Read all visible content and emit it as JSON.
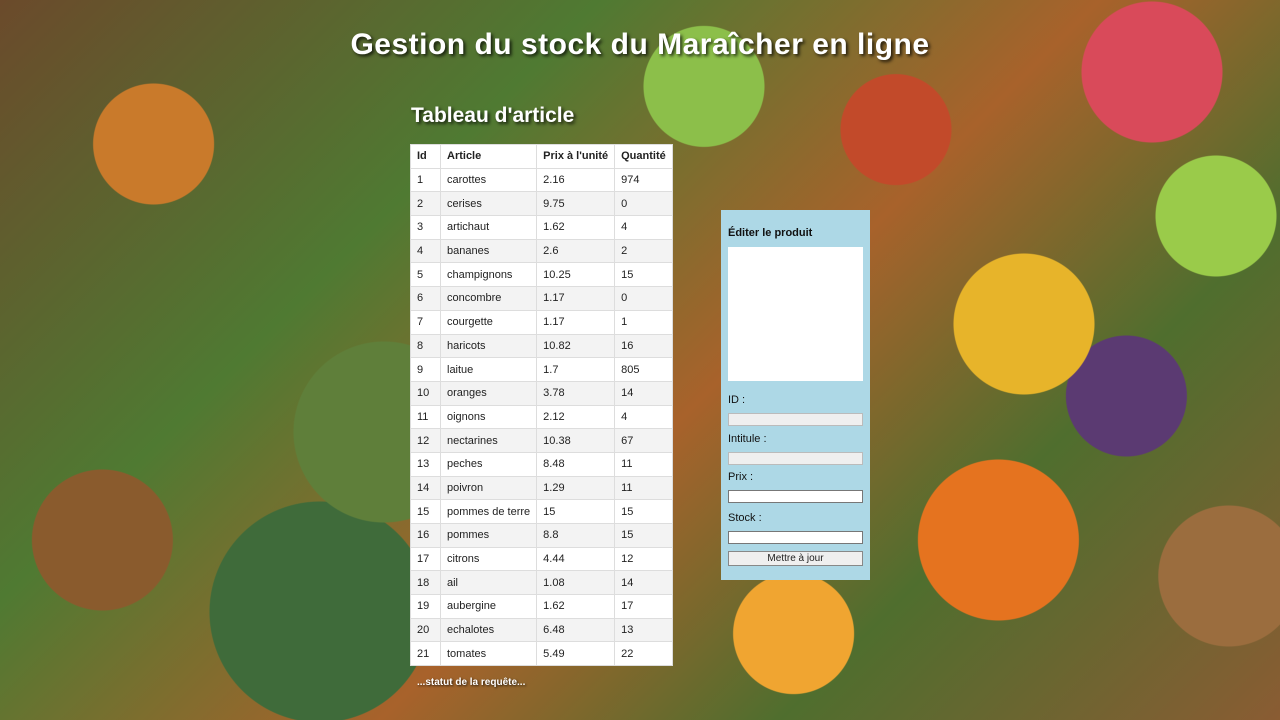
{
  "page": {
    "title": "Gestion du stock du Maraîcher en ligne",
    "table_title": "Tableau d'article",
    "status": "...statut de la requête..."
  },
  "table": {
    "headers": [
      "Id",
      "Article",
      "Prix à l'unité",
      "Quantité"
    ],
    "rows": [
      [
        "1",
        "carottes",
        "2.16",
        "974"
      ],
      [
        "2",
        "cerises",
        "9.75",
        "0"
      ],
      [
        "3",
        "artichaut",
        "1.62",
        "4"
      ],
      [
        "4",
        "bananes",
        "2.6",
        "2"
      ],
      [
        "5",
        "champignons",
        "10.25",
        "15"
      ],
      [
        "6",
        "concombre",
        "1.17",
        "0"
      ],
      [
        "7",
        "courgette",
        "1.17",
        "1"
      ],
      [
        "8",
        "haricots",
        "10.82",
        "16"
      ],
      [
        "9",
        "laitue",
        "1.7",
        "805"
      ],
      [
        "10",
        "oranges",
        "3.78",
        "14"
      ],
      [
        "11",
        "oignons",
        "2.12",
        "4"
      ],
      [
        "12",
        "nectarines",
        "10.38",
        "67"
      ],
      [
        "13",
        "peches",
        "8.48",
        "11"
      ],
      [
        "14",
        "poivron",
        "1.29",
        "11"
      ],
      [
        "15",
        "pommes de terre",
        "15",
        "15"
      ],
      [
        "16",
        "pommes",
        "8.8",
        "15"
      ],
      [
        "17",
        "citrons",
        "4.44",
        "12"
      ],
      [
        "18",
        "ail",
        "1.08",
        "14"
      ],
      [
        "19",
        "aubergine",
        "1.62",
        "17"
      ],
      [
        "20",
        "echalotes",
        "6.48",
        "13"
      ],
      [
        "21",
        "tomates",
        "5.49",
        "22"
      ]
    ]
  },
  "editor": {
    "title": "Éditer le produit",
    "id_label": "ID :",
    "id_value": "",
    "name_label": "Intitule :",
    "name_value": "",
    "price_label": "Prix :",
    "price_value": "",
    "stock_label": "Stock :",
    "stock_value": "",
    "submit_label": "Mettre à jour"
  },
  "colors": {
    "panel_bg": "#add8e6",
    "title_text": "#ffffff"
  }
}
